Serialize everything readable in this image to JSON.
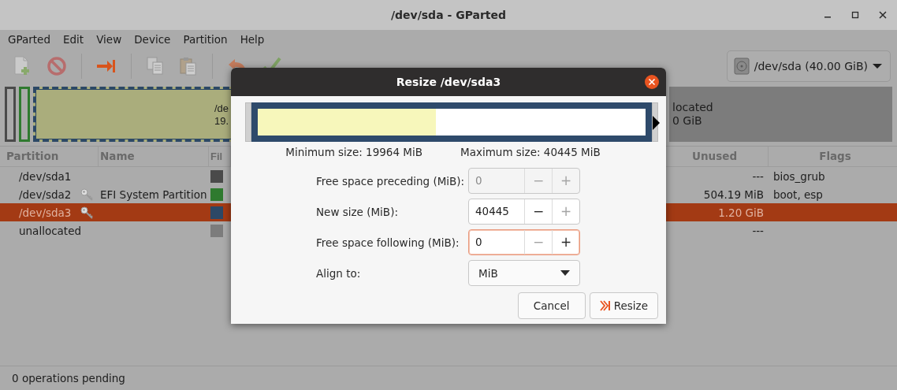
{
  "window": {
    "title": "/dev/sda - GParted"
  },
  "menu": [
    "GParted",
    "Edit",
    "View",
    "Device",
    "Partition",
    "Help"
  ],
  "toolbar": [
    {
      "kind": "new",
      "disabled": true
    },
    {
      "kind": "delete",
      "disabled": true
    },
    {
      "kind": "resize",
      "disabled": false
    },
    {
      "kind": "copy",
      "disabled": true
    },
    {
      "kind": "paste",
      "disabled": true
    },
    {
      "kind": "undo",
      "disabled": true
    },
    {
      "kind": "apply",
      "disabled": true
    }
  ],
  "device_selector": {
    "label": "/dev/sda (40.00 GiB)"
  },
  "disk_map": [
    {
      "kind": "slim",
      "color": "#4a4a4a",
      "selected": false
    },
    {
      "kind": "slim",
      "color": "#2f7a2f",
      "selected": false
    },
    {
      "kind": "wide",
      "color": "#2c4866",
      "selected": true,
      "name": "/de",
      "size": "19."
    },
    {
      "kind": "free",
      "color": "#7c7c7c",
      "selected": false,
      "name": "located",
      "size": "0 GiB"
    }
  ],
  "table": {
    "columns": [
      "Partition",
      "Name",
      "Fil",
      "Unused",
      "Flags"
    ],
    "rows": [
      {
        "partition": "/dev/sda1",
        "busy": false,
        "color": "#4a4a4a",
        "unused": "---",
        "flags": "bios_grub",
        "selected": false
      },
      {
        "partition": "/dev/sda2",
        "busy": true,
        "name": "EFI System Partition",
        "color": "#2f7a2f",
        "unused": "504.19 MiB",
        "flags": "boot, esp",
        "selected": false
      },
      {
        "partition": "/dev/sda3",
        "busy": true,
        "color": "#2c4866",
        "unused": "1.20 GiB",
        "selected": true
      },
      {
        "partition": "unallocated",
        "busy": false,
        "color": "#7c7c7c",
        "unused": "---",
        "selected": false
      }
    ]
  },
  "status_bar": "0 operations pending",
  "dialog": {
    "title": "Resize /dev/sda3",
    "graph": {
      "level": 0.46
    },
    "min_label": "Minimum size: 19964 MiB",
    "max_label": "Maximum size: 40445 MiB",
    "fields": [
      {
        "label": "Free space preceding (MiB):",
        "value": "0",
        "disabled": true,
        "focused": false,
        "minus": {
          "label": "−",
          "disabled": true
        },
        "plus": {
          "label": "+",
          "disabled": true
        }
      },
      {
        "label": "New size (MiB):",
        "value": "40445",
        "disabled": false,
        "focused": false,
        "minus": {
          "label": "−",
          "disabled": false
        },
        "plus": {
          "label": "+",
          "disabled": true
        }
      },
      {
        "label": "Free space following (MiB):",
        "value": "0",
        "disabled": false,
        "focused": true,
        "minus": {
          "label": "−",
          "disabled": true
        },
        "plus": {
          "label": "+",
          "disabled": false
        }
      }
    ],
    "align": {
      "label": "Align to:",
      "value": "MiB"
    },
    "buttons": [
      {
        "kind": "cancel",
        "label": "Cancel"
      },
      {
        "kind": "resize",
        "label": "Resize"
      }
    ]
  }
}
